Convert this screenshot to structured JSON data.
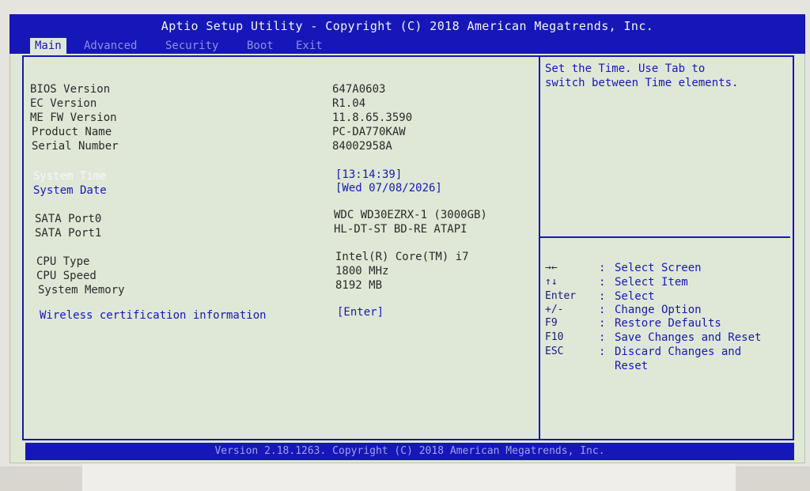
{
  "title": "Aptio Setup Utility - Copyright (C) 2018 American Megatrends, Inc.",
  "tabs": [
    {
      "label": "Main",
      "active": true
    },
    {
      "label": "Advanced",
      "active": false
    },
    {
      "label": "Security",
      "active": false
    },
    {
      "label": "Boot",
      "active": false
    },
    {
      "label": "Exit",
      "active": false
    }
  ],
  "info": {
    "bios_version": {
      "label": "BIOS Version",
      "value": "647A0603"
    },
    "ec_version": {
      "label": "EC Version",
      "value": "R1.04"
    },
    "me_fw_version": {
      "label": "ME FW Version",
      "value": "11.8.65.3590"
    },
    "product_name": {
      "label": "Product Name",
      "value": "PC-DA770KAW"
    },
    "serial_number": {
      "label": "Serial Number",
      "value": "84002958A"
    }
  },
  "system_time": {
    "label": "System Time",
    "value": "[13:14:39]"
  },
  "system_date": {
    "label": "System Date",
    "value": "[Wed 07/08/2026]"
  },
  "sata": {
    "port0": {
      "label": "SATA Port0",
      "value": "WDC WD30EZRX-1 (3000GB)"
    },
    "port1": {
      "label": "SATA Port1",
      "value": "HL-DT-ST BD-RE ATAPI"
    }
  },
  "cpu": {
    "type": {
      "label": "CPU Type",
      "value": "Intel(R) Core(TM) i7"
    },
    "speed": {
      "label": "CPU Speed",
      "value": "1800 MHz"
    },
    "memory": {
      "label": "System Memory",
      "value": "8192 MB"
    }
  },
  "wireless": {
    "label": "Wireless certification information",
    "value": "[Enter]"
  },
  "help_text": "Set the Time. Use Tab to\nswitch between Time elements.",
  "keys": [
    {
      "key": "→←",
      "sep": ":",
      "desc": "Select Screen"
    },
    {
      "key": "↑↓",
      "sep": ":",
      "desc": "Select Item"
    },
    {
      "key": "Enter",
      "sep": ":",
      "desc": "Select"
    },
    {
      "key": "+/-",
      "sep": ":",
      "desc": "Change Option"
    },
    {
      "key": "F9",
      "sep": ":",
      "desc": "Restore Defaults"
    },
    {
      "key": "F10",
      "sep": ":",
      "desc": "Save Changes and Reset"
    },
    {
      "key": "ESC",
      "sep": ":",
      "desc": "Discard Changes and\nReset"
    }
  ],
  "footer": "Version 2.18.1263. Copyright (C) 2018 American Megatrends, Inc.",
  "colors": {
    "bios_blue": "#1617B8",
    "screen_bg": "#DFE8D6",
    "selected_text": "#F6F6FF"
  }
}
